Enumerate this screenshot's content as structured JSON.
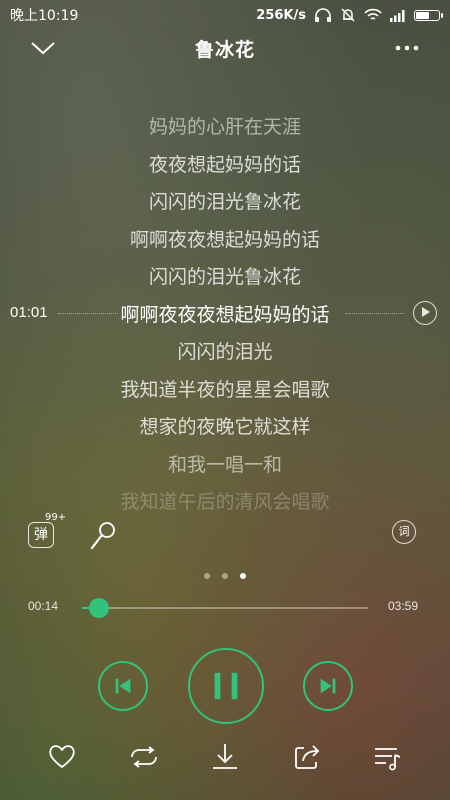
{
  "status_bar": {
    "time": "晚上10:19",
    "net_speed": "256K/s"
  },
  "header": {
    "title": "鲁冰花"
  },
  "lyrics": {
    "lines": [
      "妈妈的心肝在天涯",
      "夜夜想起妈妈的话",
      "闪闪的泪光鲁冰花",
      "啊啊夜夜想起妈妈的话",
      "闪闪的泪光鲁冰花",
      "啊啊夜夜夜想起妈妈的话",
      "闪闪的泪光",
      "我知道半夜的星星会唱歌",
      "想家的夜晚它就这样",
      "和我一唱一和",
      "我知道午后的清风会唱歌"
    ],
    "seek_time": "01:01"
  },
  "actions": {
    "danmu_label": "弹",
    "danmu_count": "99+",
    "lyric_label": "词"
  },
  "pager": {
    "count": 3,
    "active": 2
  },
  "player": {
    "elapsed": "00:14",
    "total": "03:59",
    "progress_fraction": 0.06,
    "accent_color": "#31c27c"
  },
  "bottom_icons": [
    "heart-icon",
    "repeat-icon",
    "download-icon",
    "share-icon",
    "playlist-icon"
  ]
}
